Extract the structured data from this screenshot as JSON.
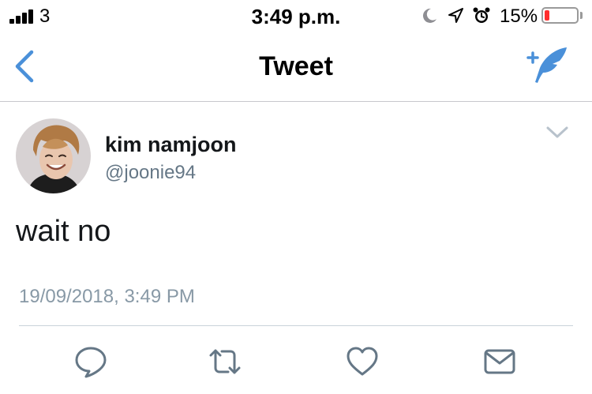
{
  "status_bar": {
    "carrier": "3",
    "time": "3:49 p.m.",
    "battery_percent": "15%",
    "battery_level": 0.15,
    "icons": [
      "signal-icon",
      "moon-icon",
      "location-arrow-icon",
      "alarm-icon",
      "battery-icon"
    ]
  },
  "nav": {
    "title": "Tweet",
    "back_icon": "chevron-left-icon",
    "compose_icon": "compose-tweet-icon"
  },
  "tweet": {
    "display_name": "kim namjoon",
    "handle": "@joonie94",
    "text": "wait no",
    "timestamp": "19/09/2018, 3:49 PM",
    "menu_icon": "chevron-down-icon"
  },
  "actions": [
    "reply-icon",
    "retweet-icon",
    "like-icon",
    "direct-message-icon"
  ],
  "colors": {
    "accent": "#1da1f2",
    "nav_icon": "#4a90d9",
    "secondary_text": "#657786",
    "timestamp_text": "#8899a6",
    "action_icon": "#657786",
    "battery_low": "#ff2d2d"
  }
}
